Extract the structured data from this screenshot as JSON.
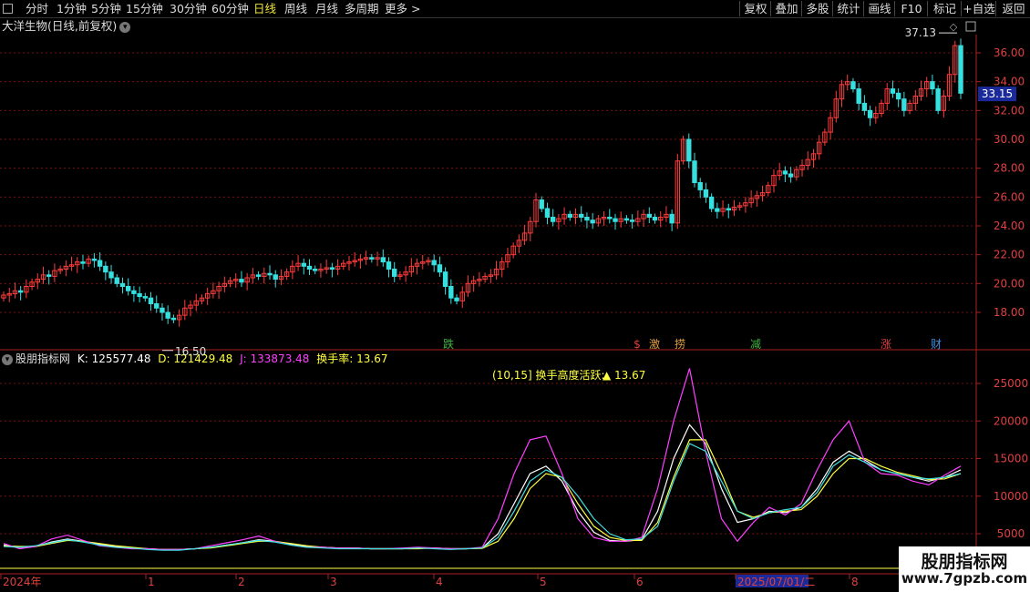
{
  "toolbar": {
    "tabs": [
      "分时",
      "1分钟",
      "5分钟",
      "15分钟",
      "30分钟",
      "60分钟",
      "日线",
      "周线",
      "月线",
      "多周期",
      "更多 >"
    ],
    "active_tab": "日线",
    "right_buttons": [
      "复权",
      "叠加",
      "多股",
      "统计",
      "画线",
      "F10",
      "标记",
      "+自选",
      "返回"
    ]
  },
  "stock": {
    "title": "大洋生物(日线,前复权)"
  },
  "price_panel": {
    "y_ticks": [
      "36.00",
      "34.00",
      "32.00",
      "30.00",
      "28.00",
      "26.00",
      "24.00",
      "22.00",
      "20.00",
      "18.00"
    ],
    "last_price": "33.15",
    "high_label": "37.13",
    "low_label": "16.50",
    "event_markers": [
      {
        "text": "跌",
        "color": "#3fb63f"
      },
      {
        "text": "$",
        "color": "#e04040"
      },
      {
        "text": "激",
        "color": "#e0a040"
      },
      {
        "text": "捞",
        "color": "#e0a040"
      },
      {
        "text": "减",
        "color": "#3fb63f"
      },
      {
        "text": "涨",
        "color": "#e04040"
      },
      {
        "text": "财",
        "color": "#4090e0"
      }
    ]
  },
  "indicator": {
    "name": "股朋指标网",
    "k": "K: 125577.48",
    "d": "D: 121429.48",
    "j": "J: 133873.48",
    "rate": "换手率: 13.67",
    "note_prefix": "(10,15] 换手高度活跃:",
    "note_value": "▲ 13.67",
    "y_ticks": [
      "25000",
      "20000",
      "15000",
      "10000",
      "5000"
    ]
  },
  "date_axis": {
    "labels": [
      "2024年",
      "1",
      "2",
      "3",
      "4",
      "5",
      "6",
      "2025/07/01/二",
      "8"
    ]
  },
  "watermark": {
    "line1": "股朋指标网",
    "line2": "www.7gpzb.com"
  },
  "colors": {
    "up": "#ff3c3c",
    "down": "#34e0e0",
    "k": "#ffffff",
    "d": "#ffff40",
    "j": "#ff40ff",
    "rate_color": "#ffff40",
    "grid": "#7a1010"
  },
  "chart_data": [
    {
      "type": "candlestick",
      "title": "大洋生物(日线,前复权)",
      "ylim": [
        16.0,
        37.5
      ],
      "close_series": [
        19.2,
        19.3,
        19.5,
        19.4,
        19.8,
        20.1,
        20.3,
        20.6,
        20.5,
        20.9,
        21.0,
        21.2,
        21.3,
        21.5,
        21.4,
        21.7,
        21.6,
        21.2,
        20.8,
        20.4,
        20.0,
        19.8,
        19.5,
        19.3,
        19.1,
        19.0,
        18.6,
        18.3,
        18.0,
        17.6,
        17.5,
        17.8,
        18.3,
        18.5,
        18.8,
        19.0,
        19.3,
        19.5,
        19.8,
        20.0,
        20.2,
        20.3,
        20.1,
        20.4,
        20.6,
        20.5,
        20.7,
        20.6,
        20.3,
        20.5,
        20.8,
        21.2,
        21.4,
        21.2,
        21.0,
        20.9,
        21.0,
        21.1,
        21.0,
        21.2,
        21.4,
        21.5,
        21.6,
        21.7,
        21.8,
        21.7,
        21.8,
        21.5,
        21.0,
        20.5,
        20.6,
        20.8,
        21.2,
        21.4,
        21.5,
        21.6,
        21.3,
        20.8,
        19.8,
        19.0,
        18.8,
        19.4,
        20.0,
        20.2,
        20.3,
        20.5,
        20.6,
        21.0,
        21.5,
        22.0,
        22.6,
        23.0,
        23.5,
        24.3,
        25.8,
        25.2,
        24.6,
        24.3,
        24.5,
        24.8,
        24.6,
        24.8,
        24.6,
        24.4,
        24.2,
        24.5,
        24.6,
        24.5,
        24.3,
        24.5,
        24.4,
        24.3,
        24.5,
        24.8,
        24.6,
        24.4,
        24.6,
        24.8,
        24.2,
        28.5,
        30.0,
        28.5,
        27.0,
        26.5,
        26.0,
        25.2,
        25.0,
        25.2,
        25.1,
        25.3,
        25.4,
        25.6,
        25.9,
        26.1,
        26.3,
        26.8,
        27.5,
        27.8,
        27.6,
        27.4,
        27.9,
        28.2,
        28.6,
        29.0,
        29.8,
        30.5,
        31.5,
        32.8,
        33.8,
        34.0,
        33.5,
        32.5,
        32.0,
        31.5,
        31.8,
        32.5,
        33.5,
        33.2,
        32.8,
        32.0,
        32.5,
        33.0,
        33.5,
        34.0,
        33.5,
        32.0,
        33.0,
        34.5,
        36.5,
        33.2
      ],
      "high": 37.13,
      "low": 16.5,
      "last": 33.15
    },
    {
      "type": "line",
      "title": "股朋指标网",
      "ylim": [
        2000,
        28000
      ],
      "series": [
        {
          "name": "K",
          "color": "#ffffff",
          "values": [
            3500,
            3200,
            3300,
            3900,
            4300,
            4000,
            3600,
            3300,
            3100,
            3000,
            2900,
            2900,
            3000,
            3200,
            3500,
            3800,
            4200,
            4000,
            3600,
            3300,
            3200,
            3100,
            3100,
            3000,
            3000,
            3000,
            3100,
            3100,
            3000,
            3000,
            3100,
            5000,
            9000,
            13000,
            14000,
            12000,
            8000,
            5200,
            4100,
            4000,
            4200,
            8000,
            15000,
            19500,
            17000,
            11000,
            6500,
            7000,
            8000,
            7800,
            8500,
            11000,
            14500,
            16000,
            14800,
            13500,
            13000,
            12500,
            12000,
            12500,
            13500
          ]
        },
        {
          "name": "D",
          "color": "#ffff40",
          "values": [
            3400,
            3300,
            3300,
            3700,
            4100,
            4000,
            3700,
            3400,
            3200,
            3000,
            2900,
            2900,
            3000,
            3100,
            3400,
            3700,
            4000,
            4000,
            3700,
            3400,
            3200,
            3100,
            3100,
            3000,
            3000,
            3000,
            3000,
            3100,
            3000,
            3000,
            3050,
            4000,
            7000,
            11000,
            13000,
            12500,
            9000,
            6000,
            4500,
            4100,
            4100,
            6500,
            12500,
            17500,
            17500,
            13000,
            8000,
            7200,
            7800,
            8000,
            8200,
            10000,
            13000,
            15000,
            15000,
            14000,
            13200,
            12700,
            12200,
            12300,
            13000
          ]
        },
        {
          "name": "J",
          "color": "#ff40ff",
          "values": [
            3700,
            3000,
            3300,
            4300,
            4800,
            4100,
            3400,
            3200,
            3000,
            3000,
            2900,
            2900,
            3000,
            3400,
            3800,
            4200,
            4700,
            4000,
            3500,
            3200,
            3200,
            3100,
            3100,
            3000,
            3000,
            3100,
            3200,
            3100,
            3000,
            3000,
            3200,
            7000,
            13000,
            17500,
            18000,
            13000,
            7000,
            4500,
            4000,
            4000,
            4500,
            11000,
            20000,
            27000,
            16000,
            7000,
            4000,
            6500,
            8500,
            7500,
            9000,
            13500,
            17500,
            20000,
            14500,
            13000,
            12800,
            12000,
            11500,
            12800,
            14000
          ]
        },
        {
          "name": "换手率",
          "color": "#40e0e0",
          "values": [
            3300,
            3200,
            3400,
            3800,
            4200,
            3900,
            3500,
            3200,
            3100,
            2900,
            2800,
            2800,
            3000,
            3200,
            3500,
            3800,
            4100,
            3900,
            3500,
            3200,
            3100,
            3000,
            3000,
            3000,
            3000,
            3000,
            3100,
            3000,
            2900,
            3000,
            3100,
            4500,
            8000,
            12000,
            13500,
            12500,
            10000,
            7000,
            5000,
            4200,
            4300,
            6000,
            12000,
            17000,
            16000,
            12000,
            8000,
            7000,
            7800,
            8200,
            8500,
            10500,
            14000,
            15500,
            14500,
            13500,
            13000,
            12500,
            12300,
            12500,
            13000
          ]
        }
      ]
    }
  ]
}
